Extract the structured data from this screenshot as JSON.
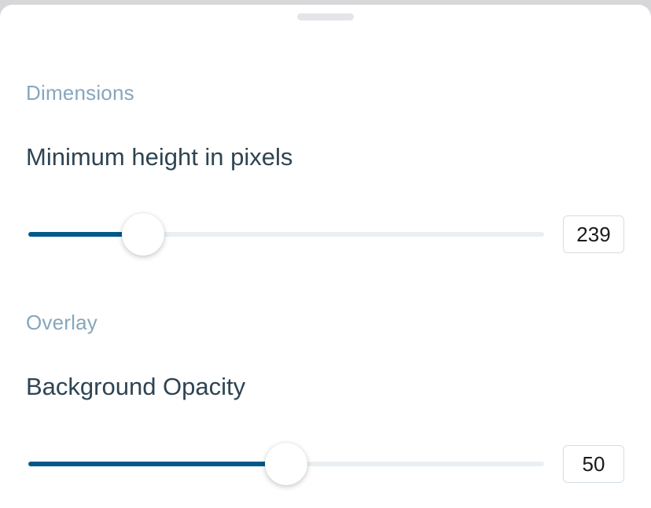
{
  "dimensions": {
    "section_label": "Dimensions",
    "min_height": {
      "label": "Minimum height in pixels",
      "value": "239",
      "fraction": 0.223
    }
  },
  "overlay": {
    "section_label": "Overlay",
    "background_opacity": {
      "label": "Background Opacity",
      "value": "50",
      "fraction": 0.5
    }
  },
  "colors": {
    "accent": "#00598a",
    "section_label": "#87a6bc",
    "text": "#2e4453",
    "track": "#e9eff3"
  }
}
